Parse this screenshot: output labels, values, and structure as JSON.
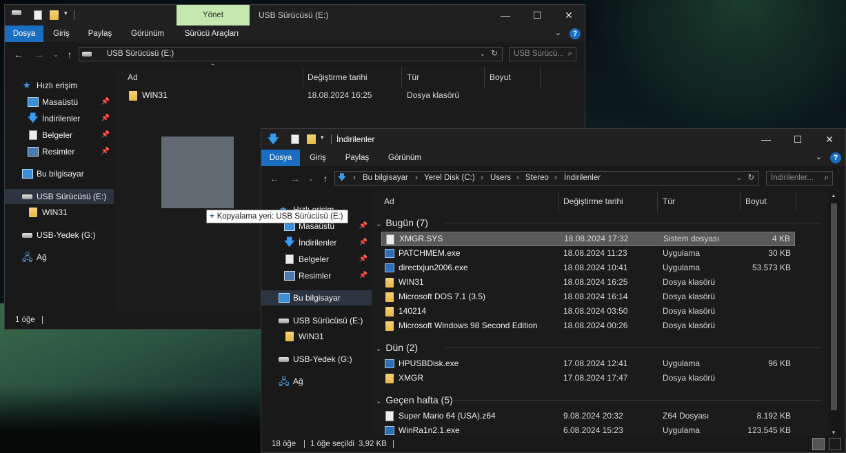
{
  "back_window": {
    "title": "USB Sürücüsü (E:)",
    "context_tab": "Yönet",
    "tabs": [
      "Dosya",
      "Giriş",
      "Paylaş",
      "Görünüm",
      "Sürücü Araçları"
    ],
    "address": "USB Sürücüsü (E:)",
    "search_placeholder": "USB Sürücü...",
    "columns": {
      "name": "Ad",
      "date": "Değiştirme tarihi",
      "type": "Tür",
      "size": "Boyut"
    },
    "rows": [
      {
        "name": "WIN31",
        "date": "18.08.2024 16:25",
        "type": "Dosya klasörü",
        "size": ""
      }
    ],
    "nav": [
      {
        "label": "Hızlı erişim",
        "icon": "star-icon"
      },
      {
        "label": "Masaüstü",
        "icon": "desktop-icon",
        "pinned": true
      },
      {
        "label": "İndirilenler",
        "icon": "download-icon",
        "pinned": true
      },
      {
        "label": "Belgeler",
        "icon": "documents-icon",
        "pinned": true
      },
      {
        "label": "Resimler",
        "icon": "pictures-icon",
        "pinned": true
      },
      {
        "label": "Bu bilgisayar",
        "icon": "computer-icon"
      },
      {
        "label": "USB Sürücüsü (E:)",
        "icon": "drive-icon"
      },
      {
        "label": "WIN31",
        "icon": "folder-icon"
      },
      {
        "label": "USB-Yedek (G:)",
        "icon": "drive-icon"
      },
      {
        "label": "Ağ",
        "icon": "network-icon"
      }
    ],
    "status": "1 öğe"
  },
  "drag_tooltip": {
    "plus": "+",
    "text": "Kopyalama yeri: USB Sürücüsü (E:)"
  },
  "front_window": {
    "title": "İndirilenler",
    "tabs": [
      "Dosya",
      "Giriş",
      "Paylaş",
      "Görünüm"
    ],
    "breadcrumb": [
      "Bu bilgisayar",
      "Yerel Disk (C:)",
      "Users",
      "Stereo",
      "İndirilenler"
    ],
    "search_placeholder": "İndirilenler...",
    "columns": {
      "name": "Ad",
      "date": "Değiştirme tarihi",
      "type": "Tür",
      "size": "Boyut"
    },
    "nav": [
      {
        "label": "Hızlı erişim",
        "icon": "star-icon"
      },
      {
        "label": "Masaüstü",
        "icon": "desktop-icon",
        "pinned": true
      },
      {
        "label": "İndirilenler",
        "icon": "download-icon",
        "pinned": true
      },
      {
        "label": "Belgeler",
        "icon": "documents-icon",
        "pinned": true
      },
      {
        "label": "Resimler",
        "icon": "pictures-icon",
        "pinned": true
      },
      {
        "label": "Bu bilgisayar",
        "icon": "computer-icon"
      },
      {
        "label": "USB Sürücüsü (E:)",
        "icon": "drive-icon"
      },
      {
        "label": "WIN31",
        "icon": "folder-icon"
      },
      {
        "label": "USB-Yedek (G:)",
        "icon": "drive-icon"
      },
      {
        "label": "Ağ",
        "icon": "network-icon"
      }
    ],
    "groups": [
      {
        "label": "Bugün (7)",
        "rows": [
          {
            "name": "XMGR.SYS",
            "date": "18.08.2024 17:32",
            "type": "Sistem dosyası",
            "size": "4 KB",
            "icon": "file",
            "selected": true
          },
          {
            "name": "PATCHMEM.exe",
            "date": "18.08.2024 11:23",
            "type": "Uygulama",
            "size": "30 KB",
            "icon": "app"
          },
          {
            "name": "directxjun2006.exe",
            "date": "18.08.2024 10:41",
            "type": "Uygulama",
            "size": "53.573 KB",
            "icon": "app"
          },
          {
            "name": "WIN31",
            "date": "18.08.2024 16:25",
            "type": "Dosya klasörü",
            "size": "",
            "icon": "folder"
          },
          {
            "name": "Microsoft DOS 7.1 (3.5)",
            "date": "18.08.2024 16:14",
            "type": "Dosya klasörü",
            "size": "",
            "icon": "folder"
          },
          {
            "name": "140214",
            "date": "18.08.2024 03:50",
            "type": "Dosya klasörü",
            "size": "",
            "icon": "folder"
          },
          {
            "name": "Microsoft Windows 98 Second Edition",
            "date": "18.08.2024 00:26",
            "type": "Dosya klasörü",
            "size": "",
            "icon": "folder"
          }
        ]
      },
      {
        "label": "Dün (2)",
        "rows": [
          {
            "name": "HPUSBDisk.exe",
            "date": "17.08.2024 12:41",
            "type": "Uygulama",
            "size": "96 KB",
            "icon": "app"
          },
          {
            "name": "XMGR",
            "date": "17.08.2024 17:47",
            "type": "Dosya klasörü",
            "size": "",
            "icon": "folder"
          }
        ]
      },
      {
        "label": "Geçen hafta (5)",
        "rows": [
          {
            "name": "Super Mario 64 (USA).z64",
            "date": "9.08.2024 20:32",
            "type": "Z64 Dosyası",
            "size": "8.192 KB",
            "icon": "file"
          },
          {
            "name": "WinRa1n2.1.exe",
            "date": "6.08.2024 15:23",
            "type": "Uygulama",
            "size": "123.545 KB",
            "icon": "app"
          }
        ]
      }
    ],
    "status": {
      "count": "18 öğe",
      "selection": "1 öğe seçildi",
      "size": "3,92 KB"
    }
  },
  "colors": {
    "accent": "#1a6ec2",
    "context_tab": "#c5e8b0",
    "background": "#191919"
  }
}
